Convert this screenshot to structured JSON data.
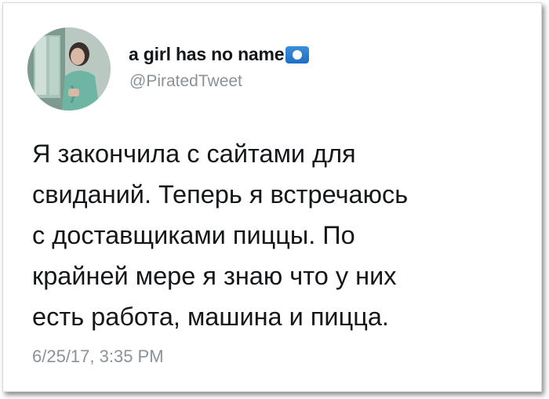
{
  "profile": {
    "display_name": "a girl has no name",
    "handle": "@PiratedTweet",
    "avatar_icon": "profile-photo",
    "verified_icon": "verified-badge-icon"
  },
  "tweet": {
    "lines": [
      "Я закончила с сайтами для",
      "свиданий. Теперь я встречаюсь",
      "с доставщиками пиццы. По",
      "крайней мере я знаю что у них",
      "есть работа, машина и пицца."
    ],
    "timestamp": "6/25/17, 3:35 PM"
  },
  "colors": {
    "text": "#14171a",
    "secondary_text": "#8a9299",
    "badge": "#1b6fc4"
  }
}
